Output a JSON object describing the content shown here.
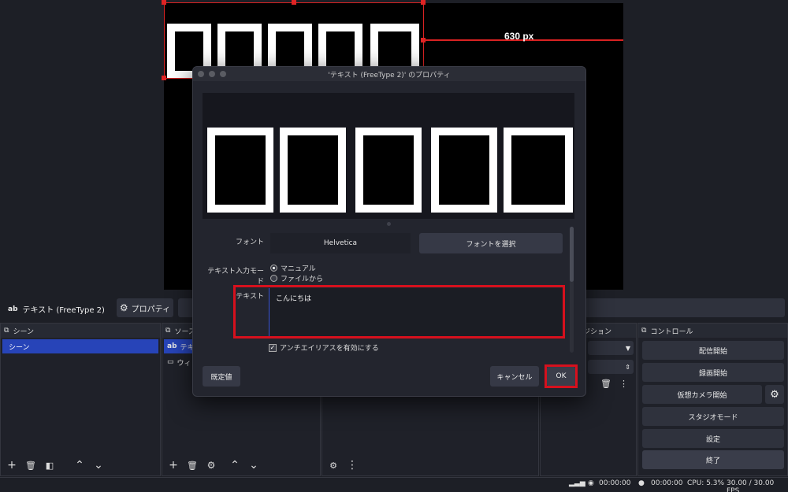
{
  "preview": {
    "guide_label": "630 px"
  },
  "source_toolbar": {
    "source_name": "テキスト (FreeType 2)",
    "properties_label": "プロパティ"
  },
  "docks": {
    "scenes": {
      "title": "シーン",
      "items": [
        "シーン"
      ]
    },
    "sources": {
      "title": "ソース",
      "items": [
        "テキ",
        "ウィ"
      ]
    },
    "transitions": {
      "title": "ジション"
    },
    "controls": {
      "title": "コントロール",
      "buttons": [
        "配信開始",
        "録画開始",
        "仮想カメラ開始",
        "スタジオモード",
        "設定",
        "終了"
      ]
    }
  },
  "status": {
    "rec_time": "00:00:00",
    "stream_time": "00:00:00",
    "cpu": "CPU: 5.3%",
    "fps": "30.00 / 30.00 FPS"
  },
  "dialog": {
    "title": "'テキスト (FreeType 2)' のプロパティ",
    "font_label": "フォント",
    "font_value": "Helvetica",
    "font_select_button": "フォントを選択",
    "input_mode_label": "テキスト入力モード",
    "input_mode_options": [
      "マニュアル",
      "ファイルから"
    ],
    "text_label": "テキスト",
    "text_value": "こんにちは",
    "antialias_label": "アンチエイリアスを有効にする",
    "defaults_button": "既定値",
    "cancel_button": "キャンセル",
    "ok_button": "OK"
  },
  "colors": {
    "accent": "#2744b8",
    "highlight": "#d6101d",
    "selection": "#d92222"
  }
}
